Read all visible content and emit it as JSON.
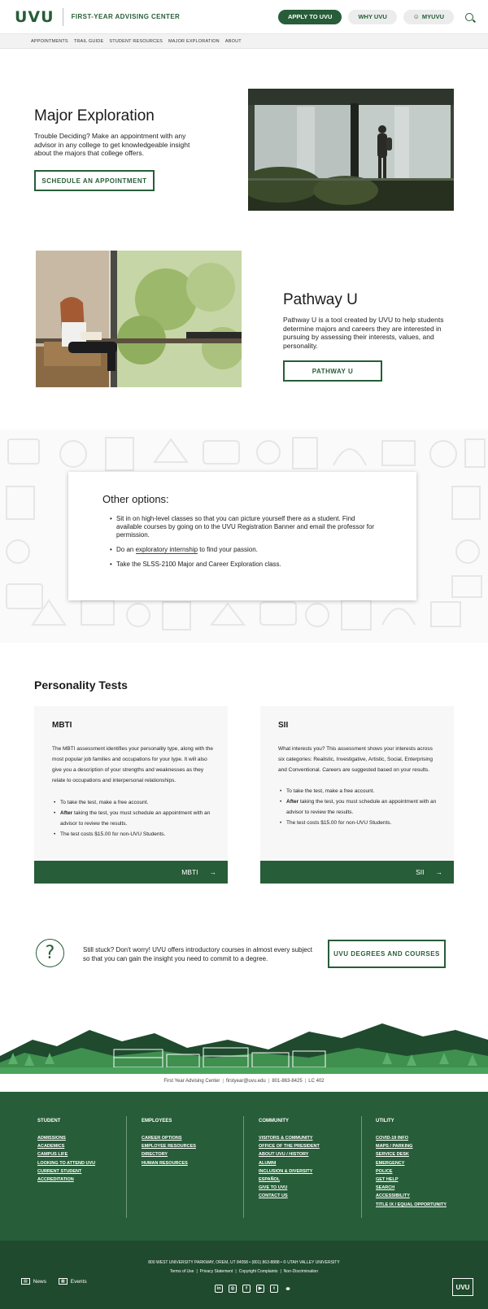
{
  "header": {
    "logo": "UVU",
    "site_title": "FIRST-YEAR ADVISING CENTER",
    "apply_label": "APPLY TO UVU",
    "why_label": "WHY UVU",
    "my_label": "MYUVU"
  },
  "subnav": [
    "APPOINTMENTS",
    "TRAIL GUIDE",
    "STUDENT RESOURCES",
    "MAJOR EXPLORATION",
    "ABOUT"
  ],
  "major": {
    "title": "Major Exploration",
    "text": "Trouble Deciding? Make an appointment with any advisor in any college to get knowledgeable insight about the majors that college offers.",
    "button": "SCHEDULE AN APPOINTMENT"
  },
  "pathway": {
    "title": "Pathway U",
    "text": "Pathway U is a tool created by UVU to help students determine majors and careers they are interested in pursuing by assessing their interests, values, and personality.",
    "button": "PATHWAY U"
  },
  "options": {
    "title": "Other options:",
    "item1": "Sit in on high-level classes so that you can picture yourself there as a student. Find available courses by going on to the UVU Registration Banner and email the professor for permission.",
    "item2_pre": "Do an ",
    "item2_link": "exploratory internship",
    "item2_post": " to find your passion.",
    "item3": "Take the SLSS-2100 Major and Career Exploration class."
  },
  "personality": {
    "title": "Personality Tests",
    "mbti": {
      "title": "MBTI",
      "desc": "The MBTI assessment identifies your personality type, along with the most popular job families and occupations for your type. It will also give you a description of your strengths and weaknesses as they relate to occupations and interpersonal relationships.",
      "b1": "To take the test, make a free account.",
      "b2_bold": "After",
      "b2": " taking the test, you must schedule an appointment with an advisor to review the results.",
      "b3": "The test costs $15.00 for non-UVU Students.",
      "button": "MBTI"
    },
    "sii": {
      "title": "SII",
      "desc": "What interests you? This assessment shows your interests across six categories: Realistic, Investigative, Artistic, Social, Enterprising and Conventional. Careers are suggested based on your results.",
      "b1": "To take the test, make a free account.",
      "b2_bold": "After",
      "b2": " taking the test, you must schedule an appointment with an advisor to review the results.",
      "b3": "The test costs $15.00 for non-UVU Students.",
      "button": "SII"
    }
  },
  "stuck": {
    "icon_glyph": "?",
    "text": "Still stuck? Don't worry! UVU offers introductory courses in almost every subject so that you can gain the insight you need to commit to a degree.",
    "button": "UVU DEGREES AND COURSES"
  },
  "contact": {
    "name": "First Year Advising Center",
    "email": "firstyear@uvu.edu",
    "phone": "801-863-8425",
    "room": "LC 402"
  },
  "footer": {
    "student": {
      "title": "STUDENT",
      "links": [
        "ADMISSIONS",
        "ACADEMICS",
        "CAMPUS LIFE",
        "LOOKING TO ATTEND UVU",
        "CURRENT STUDENT",
        "ACCREDITATION"
      ]
    },
    "employees": {
      "title": "EMPLOYEES",
      "links": [
        "CAREER OPTIONS",
        "EMPLOYEE RESOURCES",
        "DIRECTORY",
        "HUMAN RESOURCES"
      ]
    },
    "community": {
      "title": "COMMUNITY",
      "links": [
        "VISITORS & COMMUNITY",
        "OFFICE OF THE PRESIDENT",
        "ABOUT UVU / HISTORY",
        "ALUMNI",
        "INCLUSION & DIVERSITY",
        "ESPAÑOL",
        "GIVE TO UVU",
        "CONTACT US"
      ]
    },
    "utility": {
      "title": "UTILITY",
      "links": [
        "COVID-19 INFO",
        "MAPS / PARKING",
        "SERVICE DESK",
        "EMERGENCY",
        "POLICE",
        "GET HELP",
        "SEARCH",
        "ACCESSIBILITY",
        "TITLE IX / EQUAL OPPORTUNITY"
      ]
    }
  },
  "bottom": {
    "address": "800 WEST UNIVERSITY PARKWAY, OREM, UT 84058 • (801) 863-8888 • © UTAH VALLEY UNIVERSITY",
    "links": [
      "Terms of Use",
      "Privacy Statement",
      "Copyright Complaints",
      "Non-Discrimination"
    ],
    "news": "News",
    "events": "Events",
    "logo_small": "UVU"
  },
  "colors": {
    "brand_green": "#275d38",
    "footer_dark": "#1f4a2e"
  }
}
